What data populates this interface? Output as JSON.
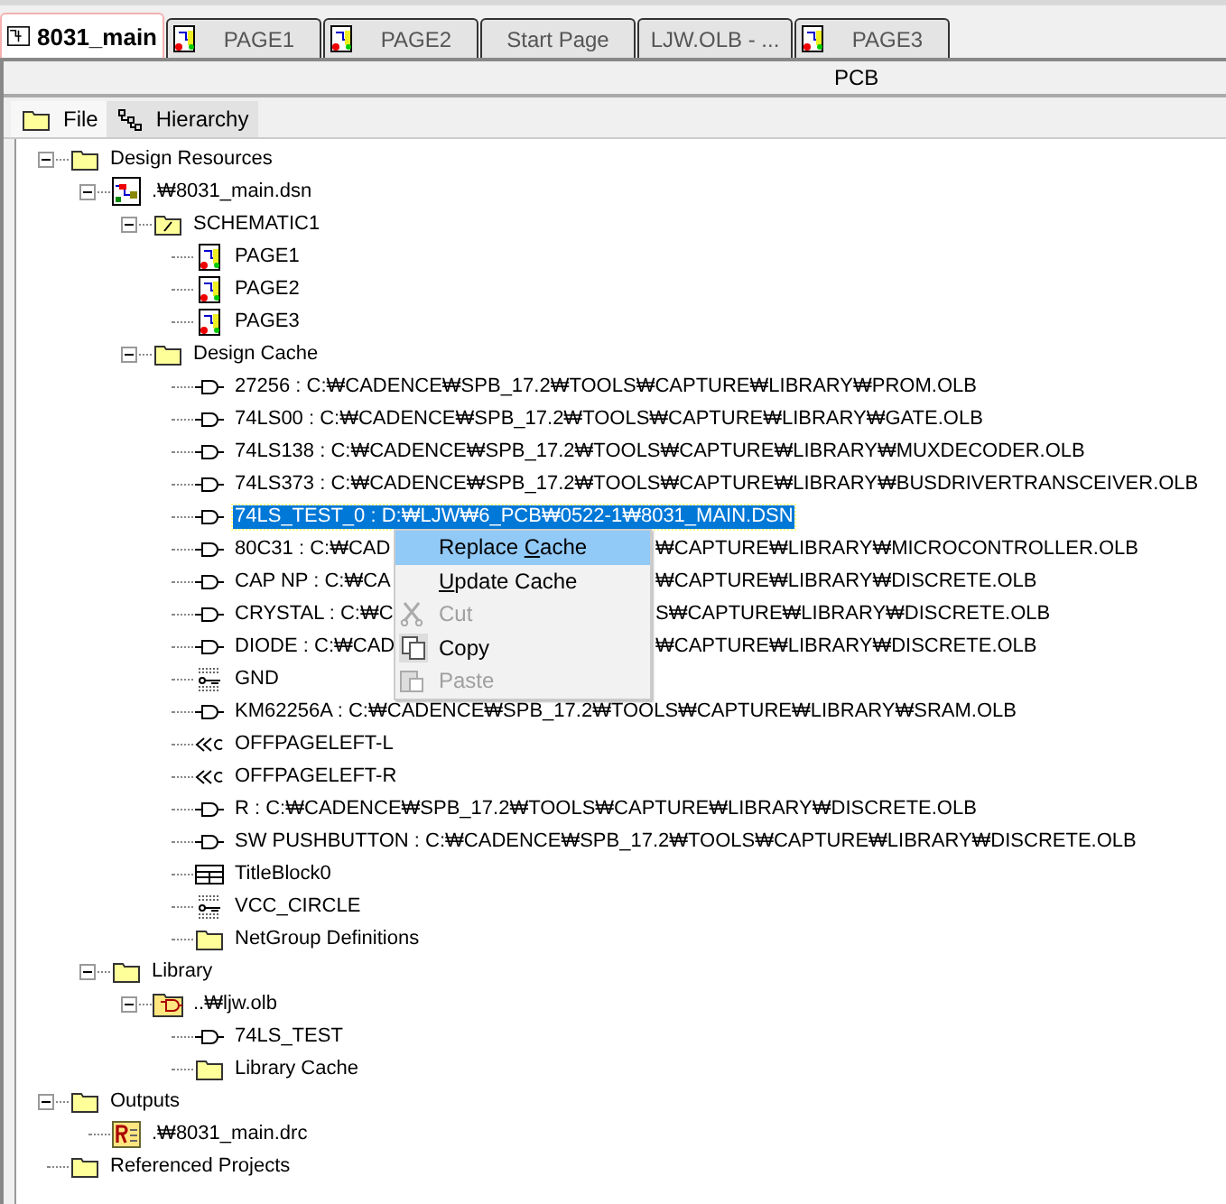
{
  "doc_tabs": [
    {
      "label": "8031_main",
      "selected": true,
      "kind": "design"
    },
    {
      "label": "PAGE1",
      "selected": false,
      "kind": "page"
    },
    {
      "label": "PAGE2",
      "selected": false,
      "kind": "page"
    },
    {
      "label": "Start Page",
      "selected": false,
      "kind": "none"
    },
    {
      "label": "LJW.OLB - ...",
      "selected": false,
      "kind": "none"
    },
    {
      "label": "PAGE3",
      "selected": false,
      "kind": "page"
    }
  ],
  "header": {
    "title": "PCB"
  },
  "view_tabs": [
    {
      "label": "File",
      "selected": true,
      "kind": "folder"
    },
    {
      "label": "Hierarchy",
      "selected": false,
      "kind": "hierarchy"
    }
  ],
  "tree": [
    {
      "label": "Design Resources",
      "kind": "folder",
      "expanded": true,
      "children": [
        {
          "label": ".₩8031_main.dsn",
          "kind": "design",
          "expanded": true,
          "children": [
            {
              "label": "SCHEMATIC1",
              "kind": "schematic",
              "expanded": true,
              "children": [
                {
                  "label": "PAGE1",
                  "kind": "page"
                },
                {
                  "label": "PAGE2",
                  "kind": "page"
                },
                {
                  "label": "PAGE3",
                  "kind": "page"
                }
              ]
            },
            {
              "label": "Design Cache",
              "kind": "folder",
              "expanded": true,
              "children": [
                {
                  "label": "27256 : C:₩CADENCE₩SPB_17.2₩TOOLS₩CAPTURE₩LIBRARY₩PROM.OLB",
                  "kind": "part"
                },
                {
                  "label": "74LS00 : C:₩CADENCE₩SPB_17.2₩TOOLS₩CAPTURE₩LIBRARY₩GATE.OLB",
                  "kind": "part"
                },
                {
                  "label": "74LS138 : C:₩CADENCE₩SPB_17.2₩TOOLS₩CAPTURE₩LIBRARY₩MUXDECODER.OLB",
                  "kind": "part"
                },
                {
                  "label": "74LS373 : C:₩CADENCE₩SPB_17.2₩TOOLS₩CAPTURE₩LIBRARY₩BUSDRIVERTRANSCEIVER.OLB",
                  "kind": "part"
                },
                {
                  "label": "74LS_TEST_0 : D:₩LJW₩6_PCB₩0522-1₩8031_MAIN.DSN",
                  "kind": "part",
                  "selected": true
                },
                {
                  "label": "80C31 : C:₩CAD",
                  "label_after_menu": "₩CAPTURE₩LIBRARY₩MICROCONTROLLER.OLB",
                  "kind": "part"
                },
                {
                  "label": "CAP NP : C:₩CA",
                  "label_after_menu": "₩CAPTURE₩LIBRARY₩DISCRETE.OLB",
                  "kind": "part"
                },
                {
                  "label": "CRYSTAL : C:₩C",
                  "label_after_menu": "S₩CAPTURE₩LIBRARY₩DISCRETE.OLB",
                  "kind": "part"
                },
                {
                  "label": "DIODE : C:₩CAD",
                  "label_after_menu": "₩CAPTURE₩LIBRARY₩DISCRETE.OLB",
                  "kind": "part"
                },
                {
                  "label": "GND",
                  "kind": "power"
                },
                {
                  "label": "KM62256A : C:₩CADENCE₩SPB_17.2₩TOOLS₩CAPTURE₩LIBRARY₩SRAM.OLB",
                  "kind": "part"
                },
                {
                  "label": "OFFPAGELEFT-L",
                  "kind": "offpage"
                },
                {
                  "label": "OFFPAGELEFT-R",
                  "kind": "offpage"
                },
                {
                  "label": "R : C:₩CADENCE₩SPB_17.2₩TOOLS₩CAPTURE₩LIBRARY₩DISCRETE.OLB",
                  "kind": "part"
                },
                {
                  "label": "SW PUSHBUTTON : C:₩CADENCE₩SPB_17.2₩TOOLS₩CAPTURE₩LIBRARY₩DISCRETE.OLB",
                  "kind": "part"
                },
                {
                  "label": "TitleBlock0",
                  "kind": "titleblock"
                },
                {
                  "label": "VCC_CIRCLE",
                  "kind": "power"
                },
                {
                  "label": "NetGroup Definitions",
                  "kind": "folder"
                }
              ]
            }
          ]
        },
        {
          "label": "Library",
          "kind": "folder",
          "expanded": true,
          "children": [
            {
              "label": "..₩ljw.olb",
              "kind": "library",
              "expanded": true,
              "children": [
                {
                  "label": "74LS_TEST",
                  "kind": "part"
                },
                {
                  "label": "Library Cache",
                  "kind": "folder"
                }
              ]
            }
          ]
        }
      ]
    },
    {
      "label": "Outputs",
      "kind": "folder",
      "expanded": true,
      "children": [
        {
          "label": ".₩8031_main.drc",
          "kind": "report"
        }
      ]
    },
    {
      "label": "Referenced Projects",
      "kind": "folder"
    }
  ],
  "context_menu": [
    {
      "before": "Replace ",
      "mnemonic": "C",
      "after": "ache",
      "kind": "none",
      "selected": true,
      "disabled": false
    },
    {
      "mnemonic": "U",
      "after": "pdate Cache",
      "kind": "none",
      "selected": false,
      "disabled": false
    },
    {
      "before": "Cut",
      "kind": "cut",
      "selected": false,
      "disabled": true
    },
    {
      "before": "Copy",
      "kind": "copy",
      "selected": false,
      "disabled": false
    },
    {
      "before": "Paste",
      "kind": "paste",
      "selected": false,
      "disabled": true
    }
  ]
}
